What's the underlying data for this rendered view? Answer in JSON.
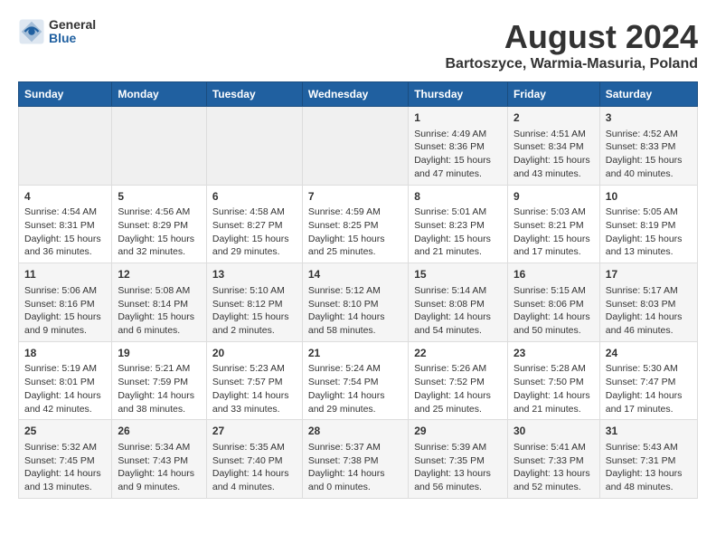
{
  "logo": {
    "general": "General",
    "blue": "Blue"
  },
  "title": "August 2024",
  "subtitle": "Bartoszyce, Warmia-Masuria, Poland",
  "days_of_week": [
    "Sunday",
    "Monday",
    "Tuesday",
    "Wednesday",
    "Thursday",
    "Friday",
    "Saturday"
  ],
  "weeks": [
    [
      {
        "day": "",
        "info": ""
      },
      {
        "day": "",
        "info": ""
      },
      {
        "day": "",
        "info": ""
      },
      {
        "day": "",
        "info": ""
      },
      {
        "day": "1",
        "info": "Sunrise: 4:49 AM\nSunset: 8:36 PM\nDaylight: 15 hours and 47 minutes."
      },
      {
        "day": "2",
        "info": "Sunrise: 4:51 AM\nSunset: 8:34 PM\nDaylight: 15 hours and 43 minutes."
      },
      {
        "day": "3",
        "info": "Sunrise: 4:52 AM\nSunset: 8:33 PM\nDaylight: 15 hours and 40 minutes."
      }
    ],
    [
      {
        "day": "4",
        "info": "Sunrise: 4:54 AM\nSunset: 8:31 PM\nDaylight: 15 hours and 36 minutes."
      },
      {
        "day": "5",
        "info": "Sunrise: 4:56 AM\nSunset: 8:29 PM\nDaylight: 15 hours and 32 minutes."
      },
      {
        "day": "6",
        "info": "Sunrise: 4:58 AM\nSunset: 8:27 PM\nDaylight: 15 hours and 29 minutes."
      },
      {
        "day": "7",
        "info": "Sunrise: 4:59 AM\nSunset: 8:25 PM\nDaylight: 15 hours and 25 minutes."
      },
      {
        "day": "8",
        "info": "Sunrise: 5:01 AM\nSunset: 8:23 PM\nDaylight: 15 hours and 21 minutes."
      },
      {
        "day": "9",
        "info": "Sunrise: 5:03 AM\nSunset: 8:21 PM\nDaylight: 15 hours and 17 minutes."
      },
      {
        "day": "10",
        "info": "Sunrise: 5:05 AM\nSunset: 8:19 PM\nDaylight: 15 hours and 13 minutes."
      }
    ],
    [
      {
        "day": "11",
        "info": "Sunrise: 5:06 AM\nSunset: 8:16 PM\nDaylight: 15 hours and 9 minutes."
      },
      {
        "day": "12",
        "info": "Sunrise: 5:08 AM\nSunset: 8:14 PM\nDaylight: 15 hours and 6 minutes."
      },
      {
        "day": "13",
        "info": "Sunrise: 5:10 AM\nSunset: 8:12 PM\nDaylight: 15 hours and 2 minutes."
      },
      {
        "day": "14",
        "info": "Sunrise: 5:12 AM\nSunset: 8:10 PM\nDaylight: 14 hours and 58 minutes."
      },
      {
        "day": "15",
        "info": "Sunrise: 5:14 AM\nSunset: 8:08 PM\nDaylight: 14 hours and 54 minutes."
      },
      {
        "day": "16",
        "info": "Sunrise: 5:15 AM\nSunset: 8:06 PM\nDaylight: 14 hours and 50 minutes."
      },
      {
        "day": "17",
        "info": "Sunrise: 5:17 AM\nSunset: 8:03 PM\nDaylight: 14 hours and 46 minutes."
      }
    ],
    [
      {
        "day": "18",
        "info": "Sunrise: 5:19 AM\nSunset: 8:01 PM\nDaylight: 14 hours and 42 minutes."
      },
      {
        "day": "19",
        "info": "Sunrise: 5:21 AM\nSunset: 7:59 PM\nDaylight: 14 hours and 38 minutes."
      },
      {
        "day": "20",
        "info": "Sunrise: 5:23 AM\nSunset: 7:57 PM\nDaylight: 14 hours and 33 minutes."
      },
      {
        "day": "21",
        "info": "Sunrise: 5:24 AM\nSunset: 7:54 PM\nDaylight: 14 hours and 29 minutes."
      },
      {
        "day": "22",
        "info": "Sunrise: 5:26 AM\nSunset: 7:52 PM\nDaylight: 14 hours and 25 minutes."
      },
      {
        "day": "23",
        "info": "Sunrise: 5:28 AM\nSunset: 7:50 PM\nDaylight: 14 hours and 21 minutes."
      },
      {
        "day": "24",
        "info": "Sunrise: 5:30 AM\nSunset: 7:47 PM\nDaylight: 14 hours and 17 minutes."
      }
    ],
    [
      {
        "day": "25",
        "info": "Sunrise: 5:32 AM\nSunset: 7:45 PM\nDaylight: 14 hours and 13 minutes."
      },
      {
        "day": "26",
        "info": "Sunrise: 5:34 AM\nSunset: 7:43 PM\nDaylight: 14 hours and 9 minutes."
      },
      {
        "day": "27",
        "info": "Sunrise: 5:35 AM\nSunset: 7:40 PM\nDaylight: 14 hours and 4 minutes."
      },
      {
        "day": "28",
        "info": "Sunrise: 5:37 AM\nSunset: 7:38 PM\nDaylight: 14 hours and 0 minutes."
      },
      {
        "day": "29",
        "info": "Sunrise: 5:39 AM\nSunset: 7:35 PM\nDaylight: 13 hours and 56 minutes."
      },
      {
        "day": "30",
        "info": "Sunrise: 5:41 AM\nSunset: 7:33 PM\nDaylight: 13 hours and 52 minutes."
      },
      {
        "day": "31",
        "info": "Sunrise: 5:43 AM\nSunset: 7:31 PM\nDaylight: 13 hours and 48 minutes."
      }
    ]
  ]
}
